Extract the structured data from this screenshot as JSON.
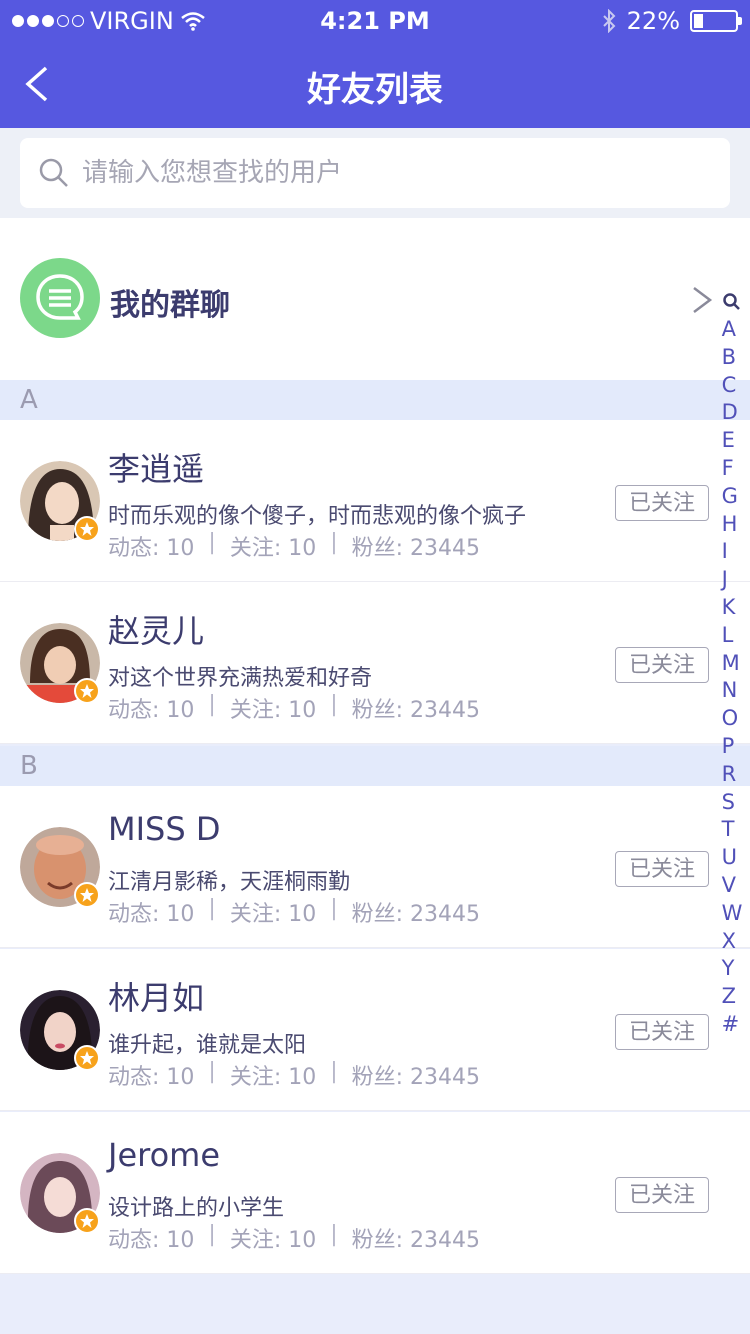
{
  "status_bar": {
    "carrier": "VIRGIN",
    "time": "4:21 PM",
    "battery": "22%",
    "battery_level": 0.22
  },
  "nav": {
    "title": "好友列表"
  },
  "search": {
    "placeholder": "请输入您想查找的用户"
  },
  "group_chat": {
    "label": "我的群聊"
  },
  "sections": [
    {
      "letter": "A",
      "friends": [
        {
          "name": "李逍遥",
          "bio": "时而乐观的像个傻子，时而悲观的像个疯子",
          "posts": "动态: 10",
          "following": "关注: 10",
          "fans": "粉丝: 23445",
          "follow_label": "已关注"
        },
        {
          "name": "赵灵儿",
          "bio": "对这个世界充满热爱和好奇",
          "posts": "动态: 10",
          "following": "关注: 10",
          "fans": "粉丝: 23445",
          "follow_label": "已关注"
        }
      ]
    },
    {
      "letter": "B",
      "friends": [
        {
          "name": "MISS D",
          "bio": "江清月影稀，天涯桐雨勤",
          "posts": "动态: 10",
          "following": "关注: 10",
          "fans": "粉丝: 23445",
          "follow_label": "已关注"
        },
        {
          "name": "林月如",
          "bio": "谁升起，谁就是太阳",
          "posts": "动态: 10",
          "following": "关注: 10",
          "fans": "粉丝: 23445",
          "follow_label": "已关注"
        },
        {
          "name": "Jerome",
          "bio": "设计路上的小学生",
          "posts": "动态: 10",
          "following": "关注: 10",
          "fans": "粉丝: 23445",
          "follow_label": "已关注"
        }
      ]
    }
  ],
  "index_letters": [
    "A",
    "B",
    "C",
    "D",
    "E",
    "F",
    "G",
    "H",
    "I",
    "J",
    "K",
    "L",
    "M",
    "N",
    "O",
    "P",
    "R",
    "S",
    "T",
    "U",
    "V",
    "W",
    "X",
    "Y",
    "Z",
    "#"
  ],
  "colors": {
    "accent": "#5658e0",
    "group_icon": "#7cd88a",
    "badge": "#f7a21b",
    "section_bg": "#e3eafb"
  }
}
